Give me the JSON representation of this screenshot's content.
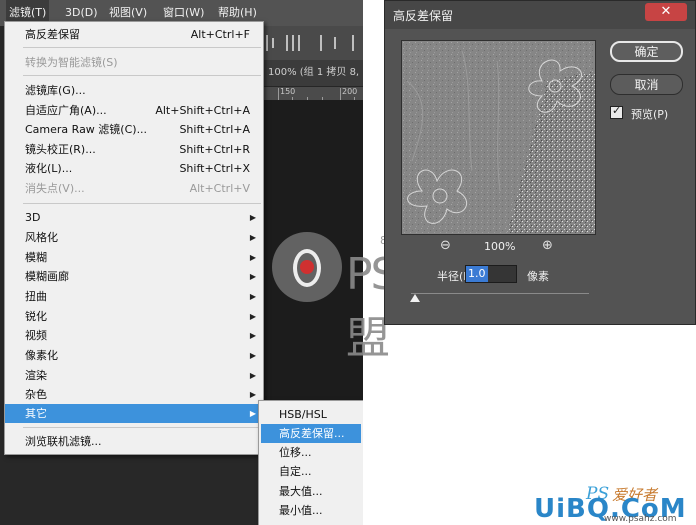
{
  "menubar": {
    "items": [
      "滤镜(T)",
      "3D(D)",
      "视图(V)",
      "窗口(W)",
      "帮助(H)"
    ]
  },
  "document": {
    "title_fragment": "100% (组 1 拷贝 8,",
    "ruler_labels": [
      "150",
      "200"
    ]
  },
  "watermark": {
    "text": "PS联盟",
    "small": "8PS.com"
  },
  "filter_menu": {
    "items": [
      {
        "label": "高反差保留",
        "shortcut": "Alt+Ctrl+F"
      },
      {
        "label": "转换为智能滤镜(S)",
        "disabled": true
      },
      {
        "label": "滤镜库(G)..."
      },
      {
        "label": "自适应广角(A)...",
        "shortcut": "Alt+Shift+Ctrl+A"
      },
      {
        "label": "Camera Raw 滤镜(C)...",
        "shortcut": "Shift+Ctrl+A"
      },
      {
        "label": "镜头校正(R)...",
        "shortcut": "Shift+Ctrl+R"
      },
      {
        "label": "液化(L)...",
        "shortcut": "Shift+Ctrl+X"
      },
      {
        "label": "消失点(V)...",
        "shortcut": "Alt+Ctrl+V",
        "disabled": true
      },
      {
        "label": "3D"
      },
      {
        "label": "风格化"
      },
      {
        "label": "模糊"
      },
      {
        "label": "模糊画廊"
      },
      {
        "label": "扭曲"
      },
      {
        "label": "锐化"
      },
      {
        "label": "视频"
      },
      {
        "label": "像素化"
      },
      {
        "label": "渲染"
      },
      {
        "label": "杂色"
      },
      {
        "label": "其它",
        "highlighted": true
      },
      {
        "label": "浏览联机滤镜..."
      }
    ]
  },
  "other_submenu": {
    "items": [
      "HSB/HSL",
      "高反差保留...",
      "位移...",
      "自定...",
      "最大值...",
      "最小值..."
    ],
    "highlighted_index": 1
  },
  "dialog": {
    "title": "高反差保留",
    "close_glyph": "✕",
    "ok_label": "确定",
    "cancel_label": "取消",
    "preview_label": "预览(P)",
    "preview_checked": true,
    "zoom_out_glyph": "⊖",
    "zoom_in_glyph": "⊕",
    "zoom_level": "100%",
    "radius_label": "半径(R):",
    "radius_value": "1.0",
    "unit_label": "像素",
    "slider_value": 0.0
  },
  "logo": {
    "ps": "PS",
    "cn": "爱好者",
    "main": "UiBQ.CoM",
    "url": "www.psahz.com"
  },
  "colors": {
    "highlight": "#3d92dc",
    "close_button": "#c74444",
    "dialog_bg": "#535353"
  }
}
